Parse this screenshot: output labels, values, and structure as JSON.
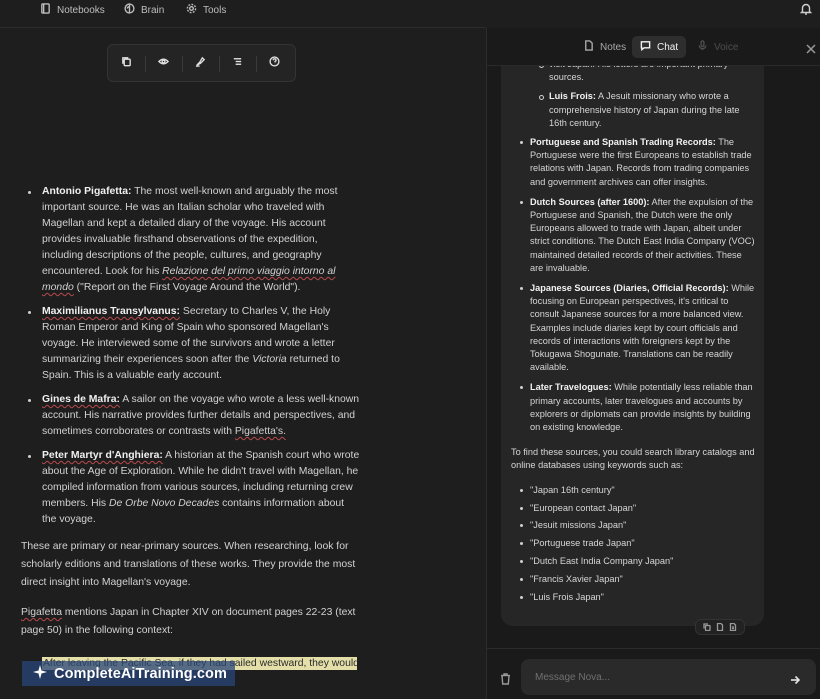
{
  "nav": {
    "items": [
      {
        "label": "Notebooks",
        "icon": "notebook-icon"
      },
      {
        "label": "Brain",
        "icon": "brain-icon"
      },
      {
        "label": "Tools",
        "icon": "gear-icon"
      }
    ],
    "bell_icon": "bell-icon"
  },
  "toolbar": {
    "buttons": [
      "copy-icon",
      "eye-icon",
      "highlighter-icon",
      "list-icon",
      "help-icon"
    ]
  },
  "editor": {
    "bullets": [
      {
        "name": "Antonio Pigafetta:",
        "text1": " The most well-known and arguably the most important source. He was an Italian scholar who traveled with Magellan and kept a detailed diary of the voyage. His account provides invaluable firsthand observations of the expedition, including descriptions of the people, cultures, and geography encountered. Look for his ",
        "italic": "Relazione del primo viaggio intorno al mondo",
        "text2": " (\"Report on the First Voyage Around the World\")."
      },
      {
        "name": "Maximilianus Transylvanus:",
        "text1": " Secretary to Charles V, the Holy Roman Emperor and King of Spain who sponsored Magellan's voyage. He interviewed some of the survivors and wrote a letter summarizing their experiences soon after the ",
        "italic": "Victoria",
        "text2": " returned to Spain. This is a valuable early account."
      },
      {
        "name": "Gines de Mafra:",
        "text1": " A sailor on the voyage who wrote a less well-known account. His narrative provides further details and perspectives, and sometimes corroborates or contrasts with ",
        "italic": "",
        "text2": "Pigafetta's."
      },
      {
        "name": "Peter Martyr d'Anghiera:",
        "text1": " A historian at the Spanish court who wrote about the Age of Exploration. While he didn't travel with Magellan, he compiled information from various sources, including returning crew members. His ",
        "italic": "De Orbe Novo Decades",
        "text2": " contains information about the voyage."
      }
    ],
    "para1": "These are primary or near-primary sources. When researching, look for scholarly editions and translations of these works. They provide the most direct insight into Magellan's voyage.",
    "para2_a": "Pigafetta",
    "para2_b": " mentions Japan in Chapter XIV on document pages 22-23 (text page 50) in the following context:",
    "highlight": "After leaving the Pacific Sea, if they had sailed westward, they would"
  },
  "watermark": {
    "text": "CompleteAiTraining.com"
  },
  "panel": {
    "tabs": [
      {
        "label": "Notes",
        "icon": "document-icon",
        "state": "normal"
      },
      {
        "label": "Chat",
        "icon": "chat-icon",
        "state": "active"
      },
      {
        "label": "Voice",
        "icon": "mic-icon",
        "state": "disabled"
      }
    ],
    "close_icon": "close-icon"
  },
  "chat": {
    "sub_items": [
      {
        "name": "",
        "text": "visit Japan. His letters are important primary sources."
      },
      {
        "name": "Luis Frois:",
        "text": " A Jesuit missionary who wrote a comprehensive history of Japan during the late 16th century."
      }
    ],
    "items": [
      {
        "name": "Portuguese and Spanish Trading Records:",
        "text": " The Portuguese were the first Europeans to establish trade relations with Japan. Records from trading companies and government archives can offer insights."
      },
      {
        "name": "Dutch Sources (after 1600):",
        "text": " After the expulsion of the Portuguese and Spanish, the Dutch were the only Europeans allowed to trade with Japan, albeit under strict conditions. The Dutch East India Company (VOC) maintained detailed records of their activities. These are invaluable."
      },
      {
        "name": "Japanese Sources (Diaries, Official Records):",
        "text": " While focusing on European perspectives, it's critical to consult Japanese sources for a more balanced view. Examples include diaries kept by court officials and records of interactions with foreigners kept by the Tokugawa Shogunate. Translations can be readily available."
      },
      {
        "name": "Later Travelogues:",
        "text": " While potentially less reliable than primary accounts, later travelogues and accounts by explorers or diplomats can provide insights by building on existing knowledge."
      }
    ],
    "find_text": "To find these sources, you could search library catalogs and online databases using keywords such as:",
    "keywords": [
      "\"Japan 16th century\"",
      "\"European contact Japan\"",
      "\"Jesuit missions Japan\"",
      "\"Portuguese trade Japan\"",
      "\"Dutch East India Company Japan\"",
      "\"Francis Xavier Japan\"",
      "\"Luis Frois Japan\""
    ],
    "actions": [
      "copy-icon",
      "document-icon",
      "export-icon"
    ]
  },
  "composer": {
    "placeholder": "Message Nova...",
    "trash_icon": "trash-icon",
    "send_icon": "send-arrow-icon"
  }
}
